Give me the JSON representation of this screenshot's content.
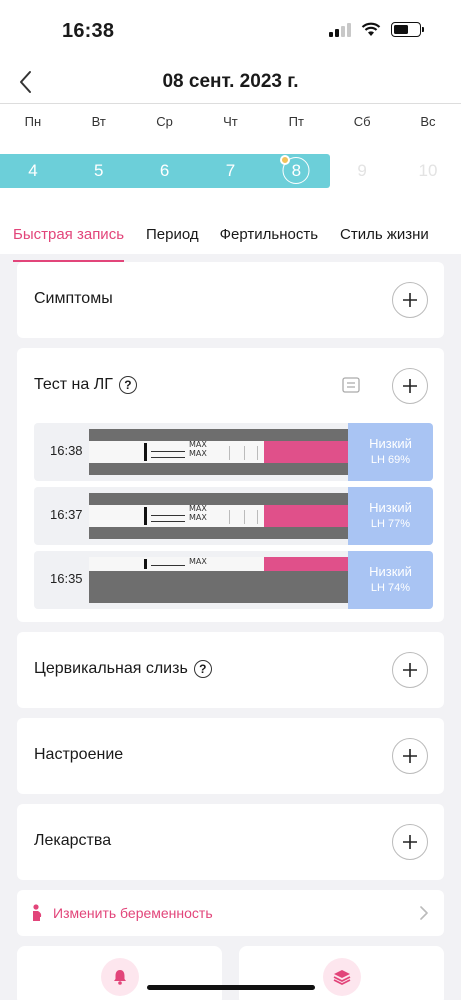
{
  "status_bar": {
    "time": "16:38"
  },
  "header": {
    "title": "08 сент. 2023 г."
  },
  "week": {
    "day_names": [
      "Пн",
      "Вт",
      "Ср",
      "Чт",
      "Пт",
      "Сб",
      "Вс"
    ],
    "day_numbers": [
      "4",
      "5",
      "6",
      "7",
      "8",
      "9",
      "10"
    ],
    "selected_day": "8"
  },
  "tabs": [
    "Быстрая запись",
    "Период",
    "Фертильность",
    "Стиль жизни"
  ],
  "cards": {
    "symptoms": "Симптомы",
    "lh_test": "Тест на ЛГ",
    "cervical": "Цервикальная слизь",
    "mood": "Настроение",
    "medicine": "Лекарства"
  },
  "help_glyph": "?",
  "lh_tests": [
    {
      "time": "16:38",
      "level": "Низкий",
      "lh": "LH 69%"
    },
    {
      "time": "16:37",
      "level": "Низкий",
      "lh": "LH 77%"
    },
    {
      "time": "16:35",
      "level": "Низкий",
      "lh": "LH 74%"
    }
  ],
  "strip_marking": "MAX",
  "pregnancy": {
    "label": "Изменить беременность"
  },
  "colors": {
    "accent": "#e2457a",
    "week_strip": "#6ccfd9",
    "lh_badge": "#a9c4f3",
    "pink_strip": "#e0508a"
  },
  "icons": [
    "back-chevron-icon",
    "plus-icon",
    "help-icon",
    "note-icon",
    "pregnant-icon",
    "chevron-right-icon",
    "bell-icon",
    "layers-icon"
  ]
}
